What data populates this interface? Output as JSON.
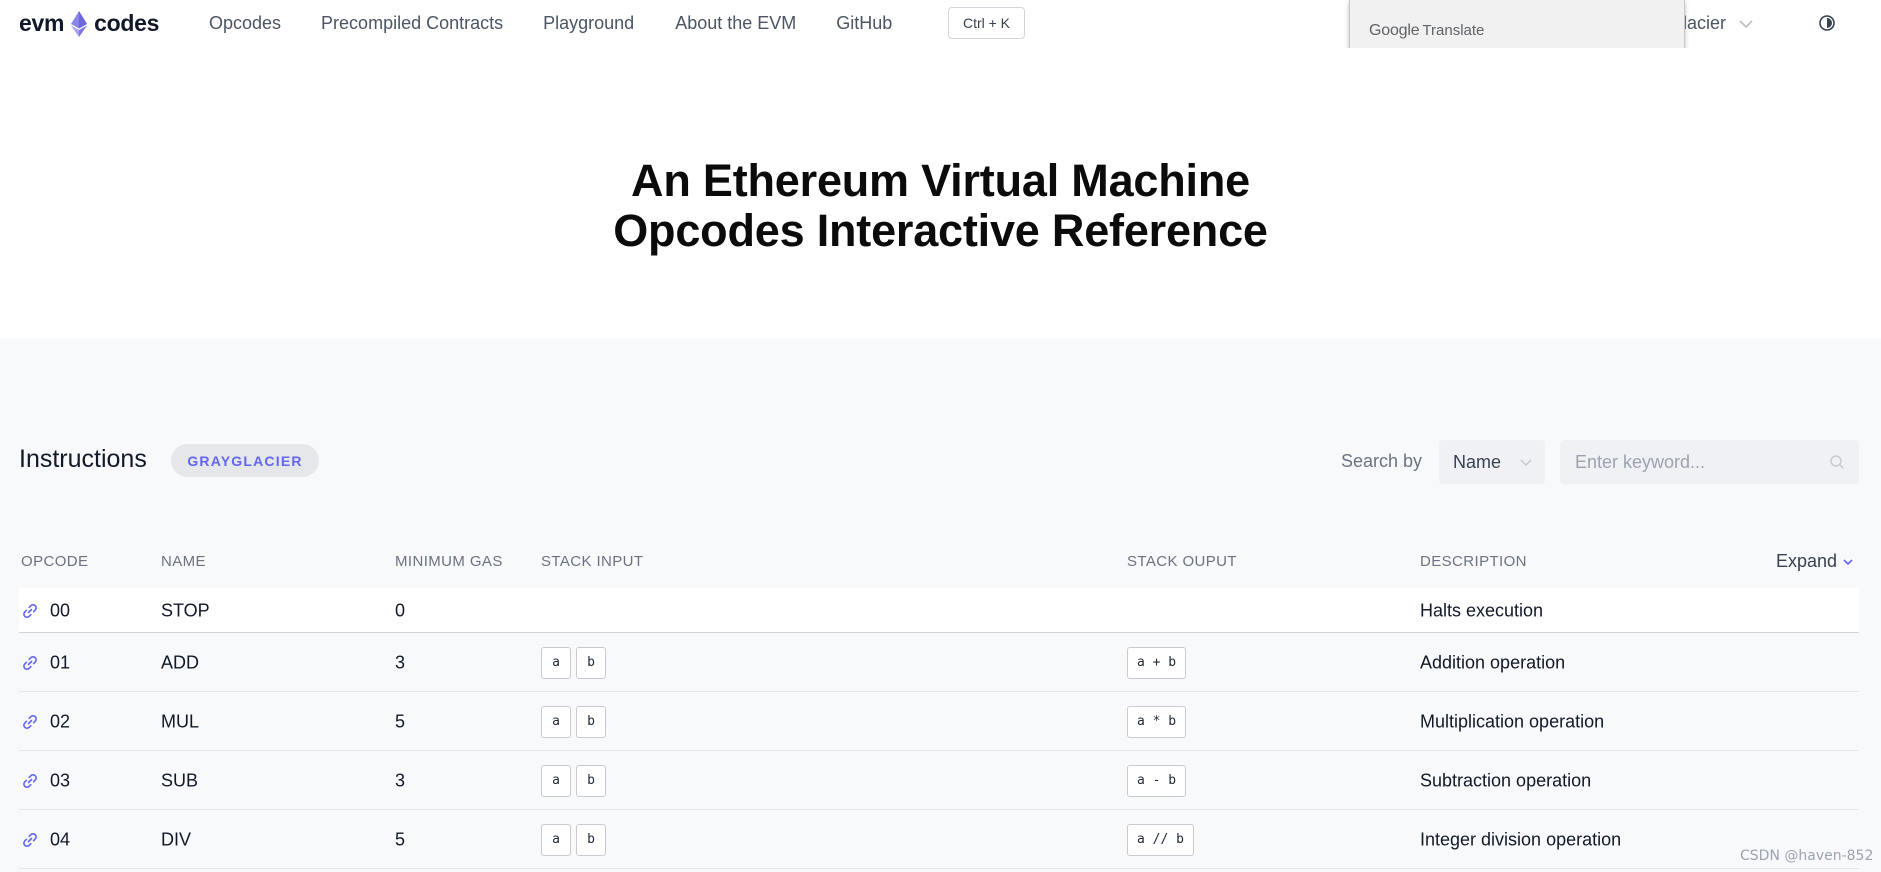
{
  "header": {
    "logo_left": "evm",
    "logo_right": "codes",
    "nav": [
      {
        "label": "Opcodes"
      },
      {
        "label": "Precompiled Contracts"
      },
      {
        "label": "Playground"
      },
      {
        "label": "About the EVM"
      },
      {
        "label": "GitHub"
      }
    ],
    "shortcut": "Ctrl + K",
    "fork_selected": "yGlacier",
    "translate_google": "Google",
    "translate_label": "Translate"
  },
  "hero": {
    "title_line1": "An Ethereum Virtual Machine",
    "title_line2": "Opcodes Interactive Reference"
  },
  "instructions": {
    "title": "Instructions",
    "fork_badge": "GRAYGLACIER",
    "search_by_label": "Search by",
    "search_type": "Name",
    "search_placeholder": "Enter keyword...",
    "columns": {
      "opcode": "OPCODE",
      "name": "NAME",
      "min_gas": "MINIMUM GAS",
      "stack_input": "STACK INPUT",
      "stack_output": "STACK OUPUT",
      "description": "DESCRIPTION"
    },
    "expand_label": "Expand",
    "rows": [
      {
        "opcode": "00",
        "name": "STOP",
        "gas": "0",
        "input": [],
        "output": [],
        "description": "Halts execution"
      },
      {
        "opcode": "01",
        "name": "ADD",
        "gas": "3",
        "input": [
          "a",
          "b"
        ],
        "output": [
          "a + b"
        ],
        "description": "Addition operation"
      },
      {
        "opcode": "02",
        "name": "MUL",
        "gas": "5",
        "input": [
          "a",
          "b"
        ],
        "output": [
          "a * b"
        ],
        "description": "Multiplication operation"
      },
      {
        "opcode": "03",
        "name": "SUB",
        "gas": "3",
        "input": [
          "a",
          "b"
        ],
        "output": [
          "a - b"
        ],
        "description": "Subtraction operation"
      },
      {
        "opcode": "04",
        "name": "DIV",
        "gas": "5",
        "input": [
          "a",
          "b"
        ],
        "output": [
          "a // b"
        ],
        "description": "Integer division operation"
      }
    ]
  },
  "watermark": "CSDN @haven-852",
  "colors": {
    "accent": "#6366f1",
    "section_bg": "#f8f9fb",
    "text": "#111827"
  }
}
